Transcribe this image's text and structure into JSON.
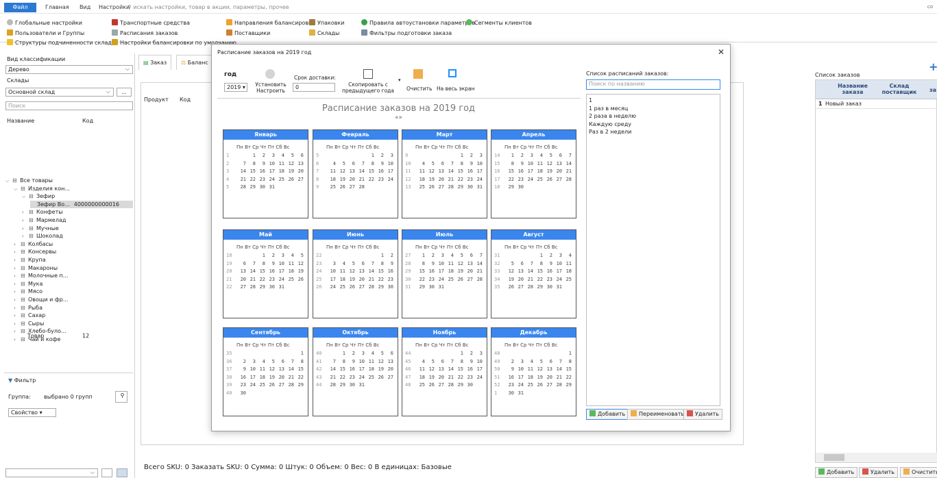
{
  "topbar": {
    "file": "Файл",
    "menu": [
      "Главная",
      "Вид",
      "Настройки"
    ],
    "search_placeholder": "искать настройки, товар в акции, параметры, прочее",
    "corner": "co"
  },
  "ribbon": {
    "items": [
      "Глобальные настройки",
      "Транспортные средства",
      "Направления балансировки",
      "Упаковки",
      "Правила автоустановки параметров",
      "Сегменты клиентов",
      "Пользователи и Группы",
      "Расписания заказов",
      "Поставщики",
      "Склады",
      "Фильтры подготовки заказа",
      "Структуры подчиненности складов",
      "Настройки балансировки по умолчанию"
    ]
  },
  "left": {
    "classif_label": "Вид классификации",
    "classif_value": "Дерево",
    "warehouses_label": "Склады",
    "warehouse_value": "Основной склад",
    "more": "...",
    "search_placeholder": "Поиск",
    "col_name": "Название",
    "col_code": "Код",
    "tree": [
      {
        "label": "Все товары",
        "level": 0,
        "exp": "v"
      },
      {
        "label": "Изделия кон...",
        "level": 1,
        "exp": "v"
      },
      {
        "label": "Зефир",
        "level": 2,
        "exp": "v"
      },
      {
        "label": "Зефир Во...",
        "level": 3,
        "exp": "",
        "code": "4000000000016",
        "sel": true
      },
      {
        "label": "Конфеты",
        "level": 2,
        "exp": ">"
      },
      {
        "label": "Мармелад",
        "level": 2,
        "exp": ">"
      },
      {
        "label": "Мучные",
        "level": 2,
        "exp": ">"
      },
      {
        "label": "Шоколад",
        "level": 2,
        "exp": ">"
      },
      {
        "label": "Колбасы",
        "level": 1,
        "exp": ">"
      },
      {
        "label": "Консервы",
        "level": 1,
        "exp": ">"
      },
      {
        "label": "Крупа",
        "level": 1,
        "exp": ">"
      },
      {
        "label": "Макароны",
        "level": 1,
        "exp": ">"
      },
      {
        "label": "Молочные п...",
        "level": 1,
        "exp": ">"
      },
      {
        "label": "Мука",
        "level": 1,
        "exp": ">"
      },
      {
        "label": "Мясо",
        "level": 1,
        "exp": ">"
      },
      {
        "label": "Овощи и фр...",
        "level": 1,
        "exp": ">"
      },
      {
        "label": "Рыба",
        "level": 1,
        "exp": ">"
      },
      {
        "label": "Сахар",
        "level": 1,
        "exp": ">"
      },
      {
        "label": "Сыры",
        "level": 1,
        "exp": ">"
      },
      {
        "label": "Хлебо-було...",
        "level": 1,
        "exp": ">"
      },
      {
        "label": "Чай и кофе",
        "level": 1,
        "exp": ">"
      }
    ],
    "total_label": "Товар",
    "total_value": "12",
    "filter_title": "Фильтр",
    "group_label": "Группа:",
    "group_value": "выбрано 0 групп",
    "property": "Свойство"
  },
  "center": {
    "tab_order": "Заказ",
    "tab_balance": "Баланс",
    "col_product": "Продукт",
    "col_code": "Код",
    "status": "Всего SKU: 0  Заказать SKU: 0  Сумма: 0  Штук: 0  Объем: 0  Вес: 0  В единицах: Базовые"
  },
  "right": {
    "title": "Список заказов",
    "col_name": "Название заказа",
    "col_wh": "Склад поставщик",
    "col_more": "за",
    "rows": [
      {
        "n": "1",
        "name": "Новый заказ"
      }
    ],
    "add": "Добавить",
    "delete": "Удалить",
    "clear": "Очистить"
  },
  "modal": {
    "title": "Расписание заказов на 2019 год",
    "year_label": "год",
    "year_value": "2019",
    "set_label": "Установить Настроить",
    "delivery_label": "Срок доставки:",
    "delivery_value": "0",
    "copy_label": "Скопировать с предыдущего года",
    "clear_label": "Очистить",
    "fullscreen_label": "На весь экран",
    "cal_title": "Расписание заказов на 2019 год",
    "nav": "«»",
    "list_title": "Список расписаний заказов:",
    "list_search_placeholder": "Поиск по названию",
    "list_items": [
      "1",
      "1 раз в месяц",
      "2 раза в неделю",
      "Каждую среду",
      "Раз в 2 недели"
    ],
    "add": "Добавить",
    "rename": "Переименовать",
    "delete": "Удалить",
    "weekdays": "Пн Вт Ср Чт Пт Сб Вс",
    "months": [
      {
        "name": "Январь",
        "weeks": [
          [
            "1",
            "",
            "1",
            "2",
            "3",
            "4",
            "5",
            "6"
          ],
          [
            "2",
            "7",
            "8",
            "9",
            "10",
            "11",
            "12",
            "13"
          ],
          [
            "3",
            "14",
            "15",
            "16",
            "17",
            "18",
            "19",
            "20"
          ],
          [
            "4",
            "21",
            "22",
            "23",
            "24",
            "25",
            "26",
            "27"
          ],
          [
            "5",
            "28",
            "29",
            "30",
            "31",
            "",
            "",
            ""
          ]
        ]
      },
      {
        "name": "Февраль",
        "weeks": [
          [
            "5",
            "",
            "",
            "",
            "",
            "1",
            "2",
            "3"
          ],
          [
            "6",
            "4",
            "5",
            "6",
            "7",
            "8",
            "9",
            "10"
          ],
          [
            "7",
            "11",
            "12",
            "13",
            "14",
            "15",
            "16",
            "17"
          ],
          [
            "8",
            "18",
            "19",
            "20",
            "21",
            "22",
            "23",
            "24"
          ],
          [
            "9",
            "25",
            "26",
            "27",
            "28",
            "",
            "",
            ""
          ]
        ]
      },
      {
        "name": "Март",
        "weeks": [
          [
            "9",
            "",
            "",
            "",
            "",
            "1",
            "2",
            "3"
          ],
          [
            "10",
            "4",
            "5",
            "6",
            "7",
            "8",
            "9",
            "10"
          ],
          [
            "11",
            "11",
            "12",
            "13",
            "14",
            "15",
            "16",
            "17"
          ],
          [
            "12",
            "18",
            "19",
            "20",
            "21",
            "22",
            "23",
            "24"
          ],
          [
            "13",
            "25",
            "26",
            "27",
            "28",
            "29",
            "30",
            "31"
          ]
        ]
      },
      {
        "name": "Апрель",
        "weeks": [
          [
            "14",
            "1",
            "2",
            "3",
            "4",
            "5",
            "6",
            "7"
          ],
          [
            "15",
            "8",
            "9",
            "10",
            "11",
            "12",
            "13",
            "14"
          ],
          [
            "16",
            "15",
            "16",
            "17",
            "18",
            "19",
            "20",
            "21"
          ],
          [
            "17",
            "22",
            "23",
            "24",
            "25",
            "26",
            "27",
            "28"
          ],
          [
            "18",
            "29",
            "30",
            "",
            "",
            "",
            "",
            ""
          ]
        ]
      },
      {
        "name": "Май",
        "weeks": [
          [
            "18",
            "",
            "",
            "1",
            "2",
            "3",
            "4",
            "5"
          ],
          [
            "19",
            "6",
            "7",
            "8",
            "9",
            "10",
            "11",
            "12"
          ],
          [
            "20",
            "13",
            "14",
            "15",
            "16",
            "17",
            "18",
            "19"
          ],
          [
            "21",
            "20",
            "21",
            "22",
            "23",
            "24",
            "25",
            "26"
          ],
          [
            "22",
            "27",
            "28",
            "29",
            "30",
            "31",
            "",
            ""
          ]
        ]
      },
      {
        "name": "Июнь",
        "weeks": [
          [
            "22",
            "",
            "",
            "",
            "",
            "",
            "1",
            "2"
          ],
          [
            "23",
            "3",
            "4",
            "5",
            "6",
            "7",
            "8",
            "9"
          ],
          [
            "24",
            "10",
            "11",
            "12",
            "13",
            "14",
            "15",
            "16"
          ],
          [
            "25",
            "17",
            "18",
            "19",
            "20",
            "21",
            "22",
            "23"
          ],
          [
            "26",
            "24",
            "25",
            "26",
            "27",
            "28",
            "29",
            "30"
          ]
        ]
      },
      {
        "name": "Июль",
        "weeks": [
          [
            "27",
            "1",
            "2",
            "3",
            "4",
            "5",
            "6",
            "7"
          ],
          [
            "28",
            "8",
            "9",
            "10",
            "11",
            "12",
            "13",
            "14"
          ],
          [
            "29",
            "15",
            "16",
            "17",
            "18",
            "19",
            "20",
            "21"
          ],
          [
            "30",
            "22",
            "23",
            "24",
            "25",
            "26",
            "27",
            "28"
          ],
          [
            "31",
            "29",
            "30",
            "31",
            "",
            "",
            "",
            ""
          ]
        ]
      },
      {
        "name": "Август",
        "weeks": [
          [
            "31",
            "",
            "",
            "",
            "1",
            "2",
            "3",
            "4"
          ],
          [
            "32",
            "5",
            "6",
            "7",
            "8",
            "9",
            "10",
            "11"
          ],
          [
            "33",
            "12",
            "13",
            "14",
            "15",
            "16",
            "17",
            "18"
          ],
          [
            "34",
            "19",
            "20",
            "21",
            "22",
            "23",
            "24",
            "25"
          ],
          [
            "35",
            "26",
            "27",
            "28",
            "29",
            "30",
            "31",
            ""
          ]
        ]
      },
      {
        "name": "Сентябрь",
        "weeks": [
          [
            "35",
            "",
            "",
            "",
            "",
            "",
            "",
            "1"
          ],
          [
            "36",
            "2",
            "3",
            "4",
            "5",
            "6",
            "7",
            "8"
          ],
          [
            "37",
            "9",
            "10",
            "11",
            "12",
            "13",
            "14",
            "15"
          ],
          [
            "38",
            "16",
            "17",
            "18",
            "19",
            "20",
            "21",
            "22"
          ],
          [
            "39",
            "23",
            "24",
            "25",
            "26",
            "27",
            "28",
            "29"
          ],
          [
            "40",
            "30",
            "",
            "",
            "",
            "",
            "",
            ""
          ]
        ]
      },
      {
        "name": "Октябрь",
        "weeks": [
          [
            "40",
            "",
            "1",
            "2",
            "3",
            "4",
            "5",
            "6"
          ],
          [
            "41",
            "7",
            "8",
            "9",
            "10",
            "11",
            "12",
            "13"
          ],
          [
            "42",
            "14",
            "15",
            "16",
            "17",
            "18",
            "19",
            "20"
          ],
          [
            "43",
            "21",
            "22",
            "23",
            "24",
            "25",
            "26",
            "27"
          ],
          [
            "44",
            "28",
            "29",
            "30",
            "31",
            "",
            "",
            ""
          ]
        ]
      },
      {
        "name": "Ноябрь",
        "weeks": [
          [
            "44",
            "",
            "",
            "",
            "",
            "1",
            "2",
            "3"
          ],
          [
            "45",
            "4",
            "5",
            "6",
            "7",
            "8",
            "9",
            "10"
          ],
          [
            "46",
            "11",
            "12",
            "13",
            "14",
            "15",
            "16",
            "17"
          ],
          [
            "47",
            "18",
            "19",
            "20",
            "21",
            "22",
            "23",
            "24"
          ],
          [
            "48",
            "25",
            "26",
            "27",
            "28",
            "29",
            "30",
            ""
          ]
        ]
      },
      {
        "name": "Декабрь",
        "weeks": [
          [
            "48",
            "",
            "",
            "",
            "",
            "",
            "",
            "1"
          ],
          [
            "49",
            "2",
            "3",
            "4",
            "5",
            "6",
            "7",
            "8"
          ],
          [
            "50",
            "9",
            "10",
            "11",
            "12",
            "13",
            "14",
            "15"
          ],
          [
            "51",
            "16",
            "17",
            "18",
            "19",
            "20",
            "21",
            "22"
          ],
          [
            "52",
            "23",
            "24",
            "25",
            "26",
            "27",
            "28",
            "29"
          ],
          [
            "1",
            "30",
            "31",
            "",
            "",
            "",
            "",
            ""
          ]
        ]
      }
    ]
  },
  "colors": {
    "accent": "#2b79d2",
    "month_header": "#3a86ee"
  }
}
